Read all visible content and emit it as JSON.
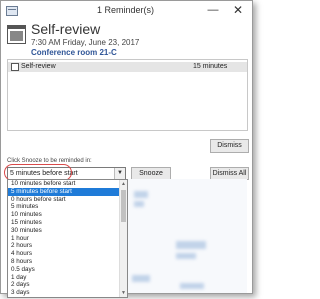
{
  "window": {
    "title": "1 Reminder(s)"
  },
  "title_buttons": {
    "minimize": "—",
    "close": "✕"
  },
  "reminder": {
    "subject": "Self-review",
    "when": "7:30 AM Friday, June 23, 2017",
    "location": "Conference room 21-C"
  },
  "list": {
    "items": [
      {
        "subject": "Self-review",
        "due_in": "15 minutes"
      }
    ]
  },
  "buttons": {
    "dismiss": "Dismiss",
    "snooze": "Snooze",
    "dismiss_all": "Dismiss All"
  },
  "snooze": {
    "label": "Click Snooze to be reminded in:",
    "selected": "5 minutes before start",
    "options": [
      "10 minutes before start",
      "5 minutes before start",
      "0 hours before start",
      "5 minutes",
      "10 minutes",
      "15 minutes",
      "30 minutes",
      "1 hour",
      "2 hours",
      "4 hours",
      "8 hours",
      "0.5 days",
      "1 day",
      "2 days",
      "3 days"
    ]
  },
  "icons": {
    "app": "calendar-small-icon",
    "reminder": "calendar-icon",
    "row": "appointment-icon",
    "dropdown": "chevron-down-icon"
  },
  "colors": {
    "highlight": "#1f7bd8",
    "location": "#2f5597",
    "annotation_ring": "#d94a4a"
  }
}
